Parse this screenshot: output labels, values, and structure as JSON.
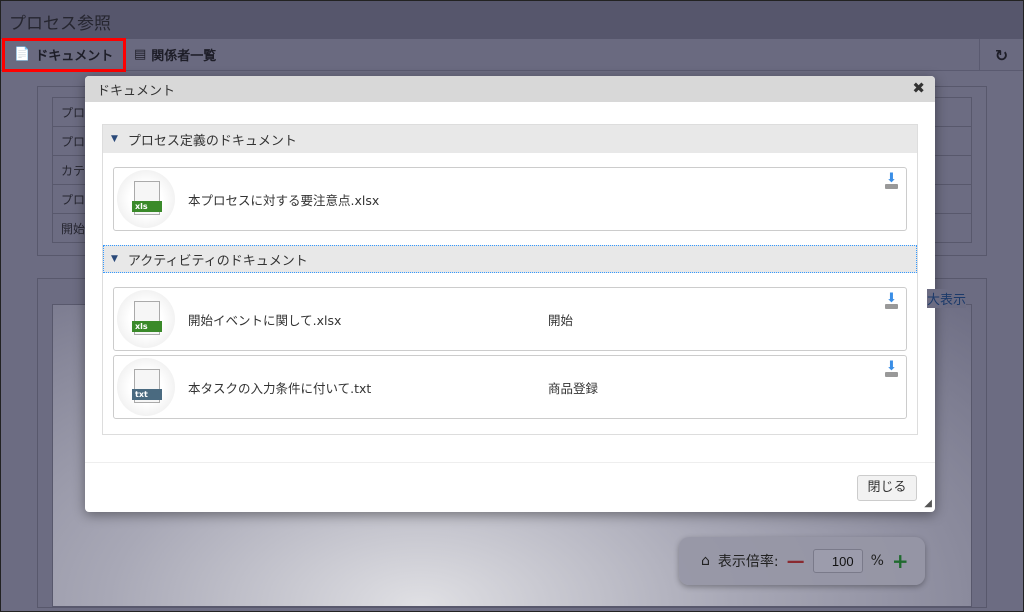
{
  "page": {
    "title": "プロセス参照"
  },
  "toolbar": {
    "document": "ドキュメント",
    "stakeholders": "関係者一覧",
    "refresh_icon": "refresh-icon"
  },
  "info_rows": [
    "プロ",
    "プロ",
    "カテ",
    "プロ",
    "開始"
  ],
  "canvas": {
    "zoom_link": "大表示",
    "zoom_label": "表示倍率:",
    "zoom_value": "100",
    "zoom_unit": "%"
  },
  "dialog": {
    "title": "ドキュメント",
    "sections": [
      {
        "label": "プロセス定義のドキュメント",
        "items": [
          {
            "name": "本プロセスに対する要注意点.xlsx",
            "type": "xls",
            "activity": ""
          }
        ]
      },
      {
        "label": "アクティビティのドキュメント",
        "items": [
          {
            "name": "開始イベントに関して.xlsx",
            "type": "xls",
            "activity": "開始"
          },
          {
            "name": "本タスクの入力条件に付いて.txt",
            "type": "txt",
            "activity": "商品登録"
          }
        ]
      }
    ],
    "close": "閉じる"
  },
  "colors": {
    "highlight": "#ff0000",
    "xls": "#3a8a2a",
    "txt": "#4a6a80"
  }
}
